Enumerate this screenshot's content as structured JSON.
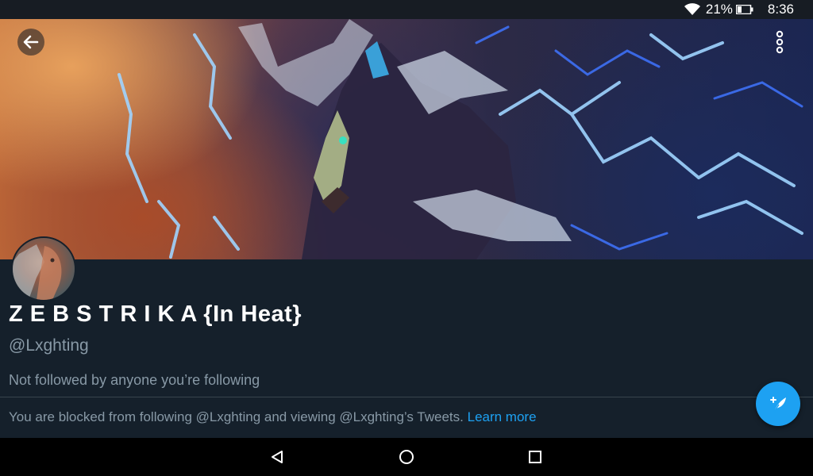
{
  "status_bar": {
    "battery_percent": "21%",
    "time": "8:36",
    "icons": [
      "wifi-icon",
      "battery-icon"
    ]
  },
  "toolbar": {
    "back_icon": "arrow-left-icon",
    "more_icon": "more-vertical-icon"
  },
  "profile": {
    "display_name": "Z E B S T R I K A {In Heat}",
    "handle": "@Lxghting",
    "followed_by": "Not followed by anyone you’re following",
    "blocked_notice": "You are blocked from following @Lxghting and viewing @Lxghting’s Tweets.",
    "learn_more": "Learn more"
  },
  "fab": {
    "icon": "compose-tweet-icon"
  },
  "nav_bar": {
    "icons": [
      "back-triangle-icon",
      "home-circle-icon",
      "recents-square-icon"
    ]
  },
  "colors": {
    "background": "#15202b",
    "accent": "#1da1f2",
    "secondary_text": "#8899a6",
    "divider": "#38444d"
  }
}
